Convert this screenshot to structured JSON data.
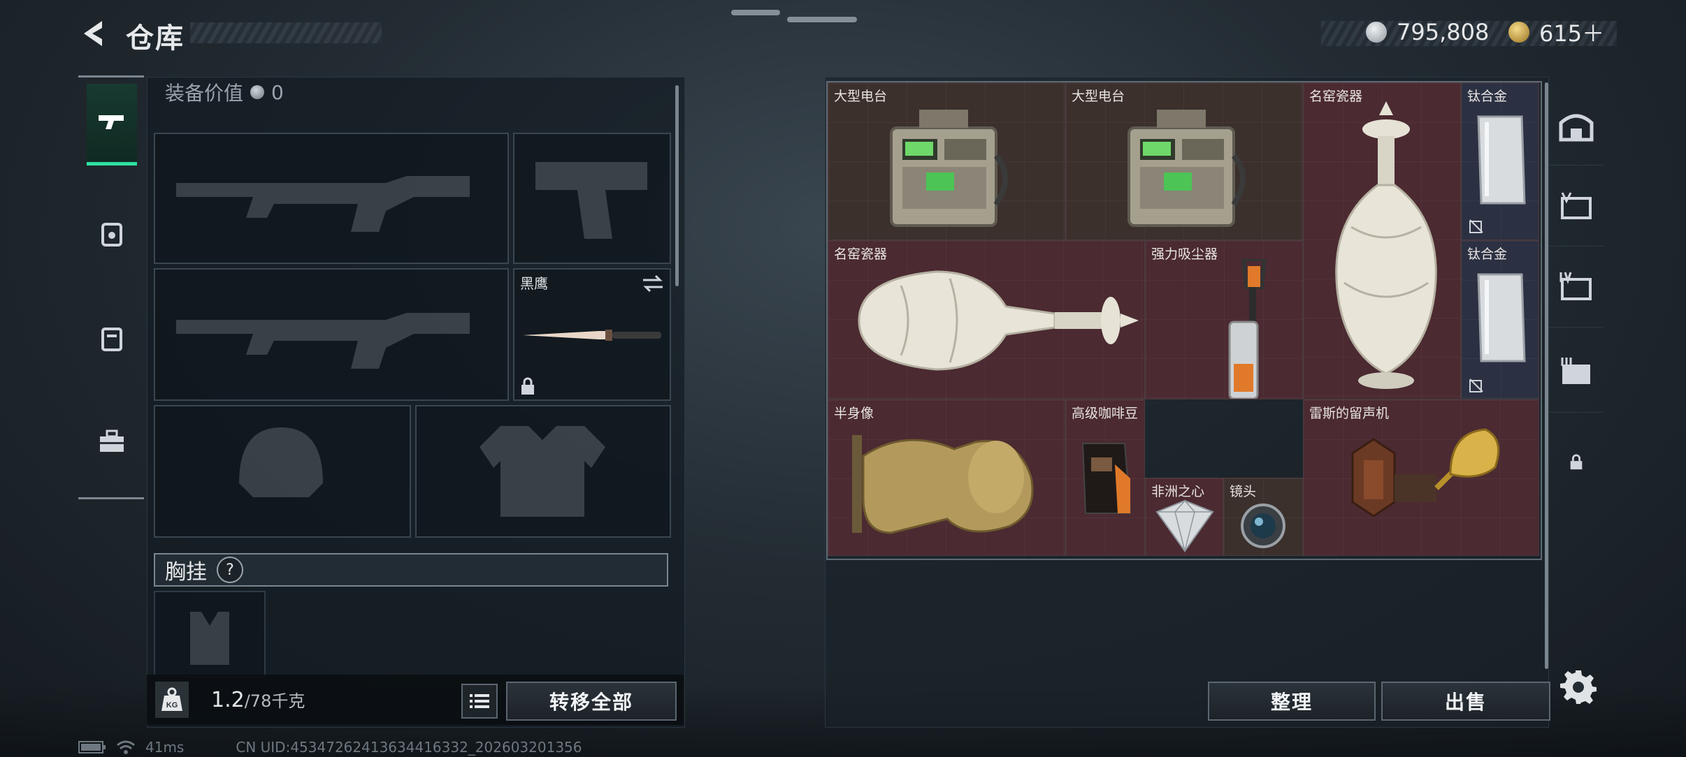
{
  "header": {
    "title": "仓库"
  },
  "currency": {
    "silver": "795,808",
    "gold": "615＋"
  },
  "loadout": {
    "equip_value_label": "装备价值",
    "equip_value": "0",
    "melee_name": "黑鹰",
    "chest_label": "胸挂",
    "chest_help": "?",
    "weight_current": "1.2",
    "weight_max": "/78千克",
    "kg_label": "KG",
    "transfer_all": "转移全部"
  },
  "storage": {
    "items": [
      {
        "label": "大型电台"
      },
      {
        "label": "大型电台"
      },
      {
        "label": "名窑瓷器"
      },
      {
        "label": "钛合金"
      },
      {
        "label": "名窑瓷器"
      },
      {
        "label": "强力吸尘器"
      },
      {
        "label": "钛合金"
      },
      {
        "label": "半身像"
      },
      {
        "label": "高级咖啡豆"
      },
      {
        "label": "雷斯的留声机"
      },
      {
        "label": "非洲之心"
      },
      {
        "label": "镜头"
      }
    ],
    "sort_button": "整理",
    "sell_button": "出售"
  },
  "right_nav": {
    "tab5_lock": "locked"
  },
  "status_bar": {
    "ping": "41ms",
    "uid": "CN UID:45347262413634416332_202603201356"
  },
  "colors": {
    "accent_green": "#2fe0a0",
    "item_red": "#4b2a31",
    "item_brown": "#3b302c",
    "item_blue": "#2b3142"
  }
}
